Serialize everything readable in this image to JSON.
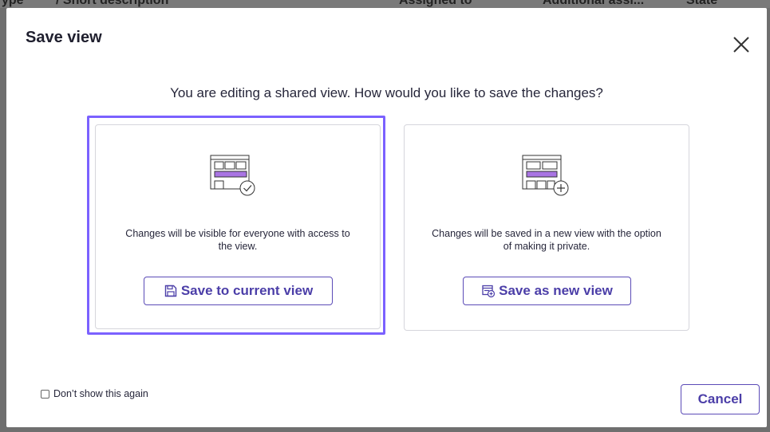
{
  "background": {
    "header_fragments": [
      "ype",
      "/ Short description",
      "Assigned to",
      "Additional assi...",
      "State"
    ]
  },
  "dialog": {
    "title": "Save view",
    "prompt": "You are editing a shared view. How would you like to save the changes?",
    "options": [
      {
        "description": "Changes will be visible for everyone with access to the view.",
        "button_label": "Save to current view",
        "button_icon": "floppy-disk-icon",
        "illustration_badge": "check-circle-icon",
        "selected": true
      },
      {
        "description": "Changes will be saved in a new view with the option of making it private.",
        "button_label": "Save as new view",
        "button_icon": "new-view-icon",
        "illustration_badge": "plus-circle-icon",
        "selected": false
      }
    ],
    "dont_show_label": "Don’t show this again",
    "dont_show_checked": false,
    "cancel_label": "Cancel"
  },
  "colors": {
    "accent": "#7b61ff",
    "button_text": "#4b3ea8",
    "illustration_bar": "#a974e3"
  }
}
